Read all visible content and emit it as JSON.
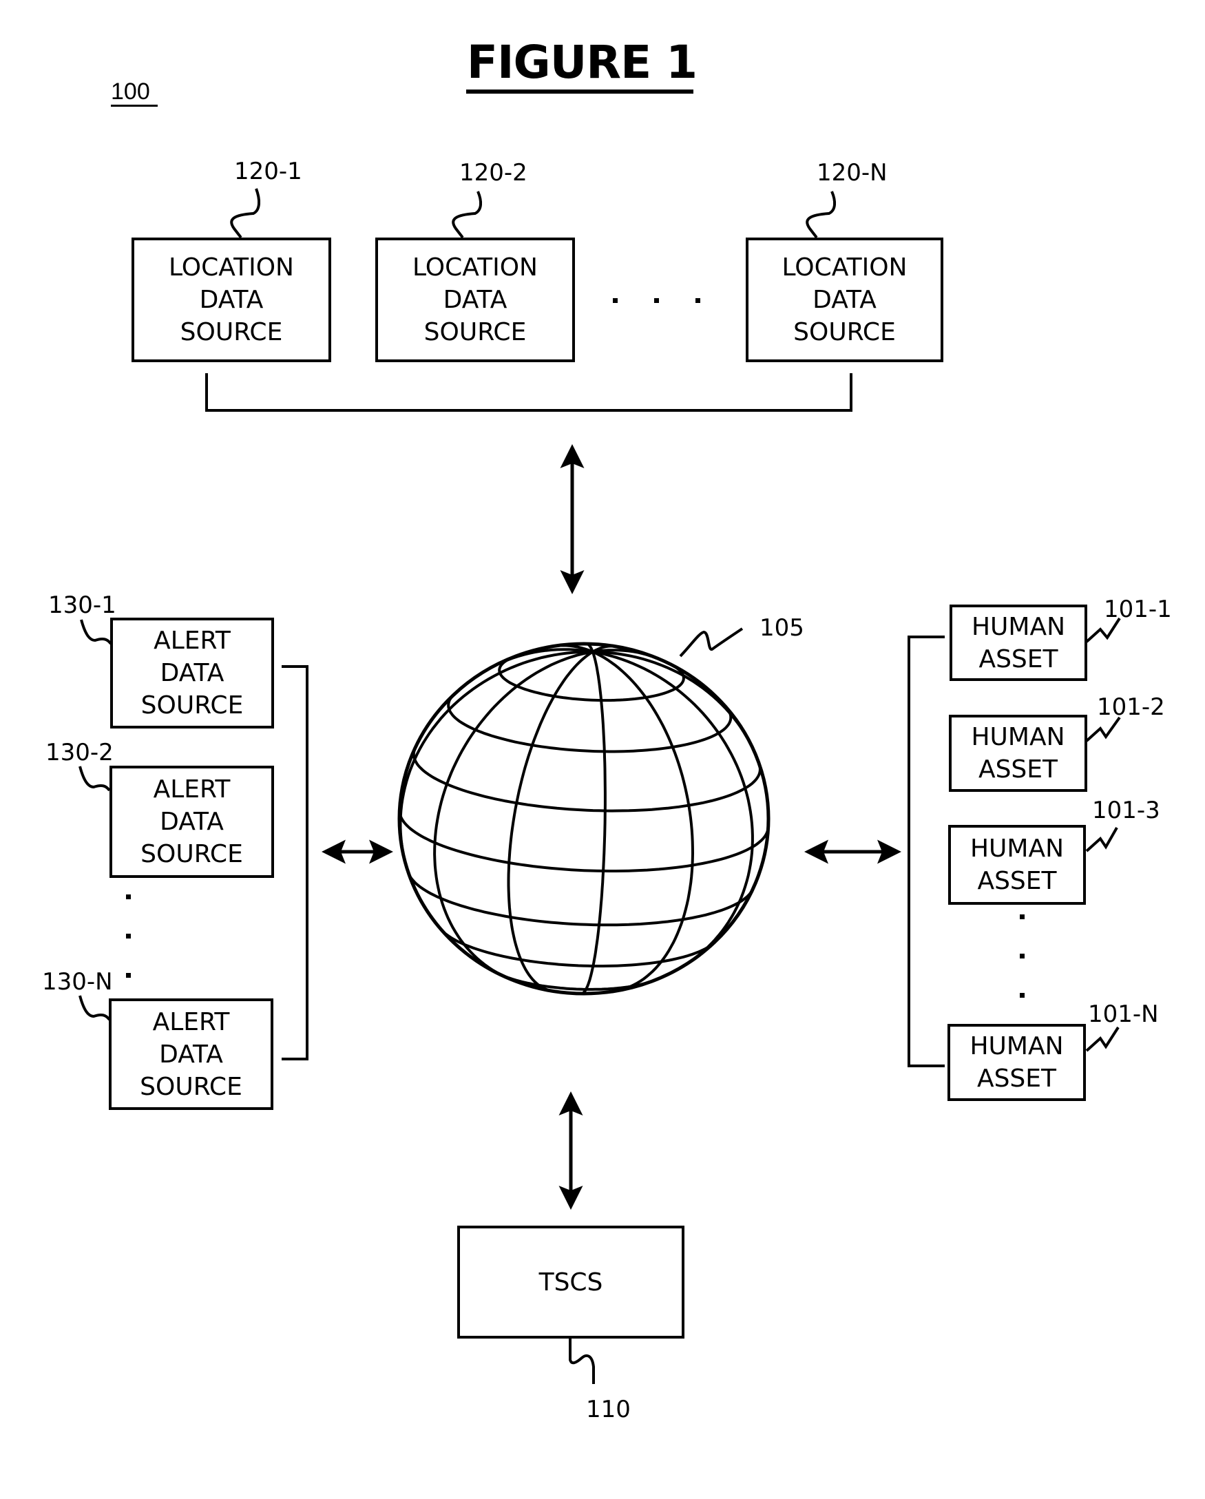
{
  "figure": {
    "title": "FIGURE 1",
    "reference": "100"
  },
  "location_sources": {
    "items": [
      {
        "ref": "120-1",
        "lines": [
          "LOCATION",
          "DATA",
          "SOURCE"
        ]
      },
      {
        "ref": "120-2",
        "lines": [
          "LOCATION",
          "DATA",
          "SOURCE"
        ]
      },
      {
        "ref": "120-N",
        "lines": [
          "LOCATION",
          "DATA",
          "SOURCE"
        ]
      }
    ],
    "ellipsis": "horizontal-dots"
  },
  "alert_sources": {
    "items": [
      {
        "ref": "130-1",
        "lines": [
          "ALERT",
          "DATA",
          "SOURCE"
        ]
      },
      {
        "ref": "130-2",
        "lines": [
          "ALERT",
          "DATA",
          "SOURCE"
        ]
      },
      {
        "ref": "130-N",
        "lines": [
          "ALERT",
          "DATA",
          "SOURCE"
        ]
      }
    ],
    "ellipsis": "vertical-dots"
  },
  "network": {
    "ref": "105",
    "icon": "globe-icon"
  },
  "human_assets": {
    "items": [
      {
        "ref": "101-1",
        "lines": [
          "HUMAN",
          "ASSET"
        ]
      },
      {
        "ref": "101-2",
        "lines": [
          "HUMAN",
          "ASSET"
        ]
      },
      {
        "ref": "101-3",
        "lines": [
          "HUMAN",
          "ASSET"
        ]
      },
      {
        "ref": "101-N",
        "lines": [
          "HUMAN",
          "ASSET"
        ]
      }
    ],
    "ellipsis": "vertical-dots"
  },
  "tscs": {
    "ref": "110",
    "label": "TSCS"
  },
  "connections": [
    {
      "from": "location_sources",
      "to": "network",
      "type": "bidirectional-arrow"
    },
    {
      "from": "alert_sources",
      "to": "network",
      "type": "bidirectional-arrow"
    },
    {
      "from": "human_assets",
      "to": "network",
      "type": "bidirectional-arrow"
    },
    {
      "from": "tscs",
      "to": "network",
      "type": "bidirectional-arrow"
    }
  ],
  "colors": {
    "ink": "#000000",
    "paper": "#ffffff"
  }
}
